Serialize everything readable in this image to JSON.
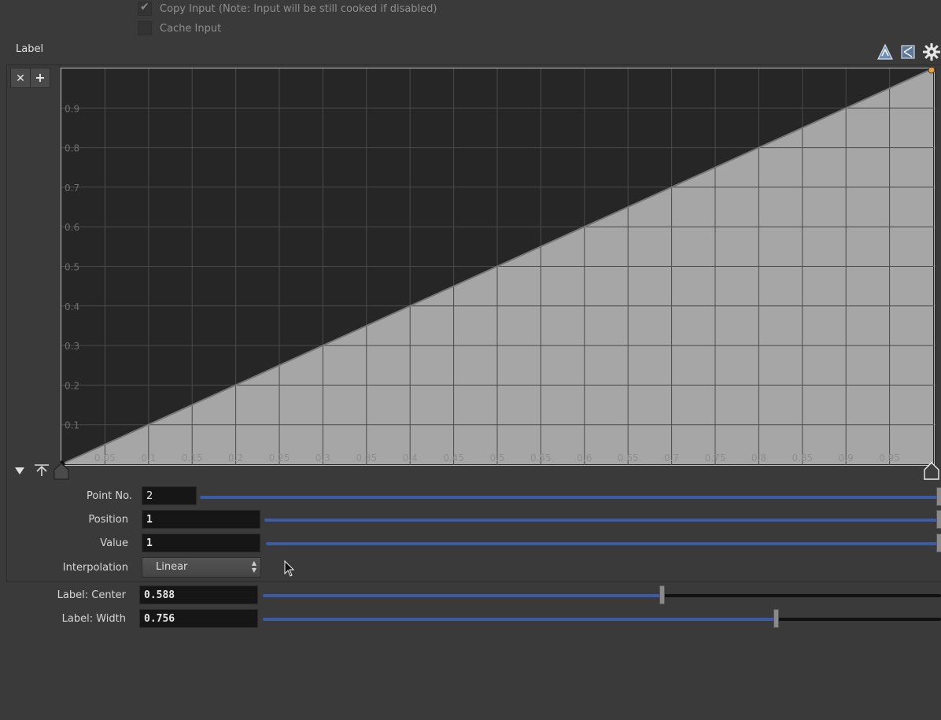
{
  "options": {
    "copy_input_label": "Copy Input (Note: Input will be still cooked if disabled)",
    "cache_input_label": "Cache Input"
  },
  "ramp": {
    "label": "Label",
    "remove_icon": "close-icon",
    "add_icon": "plus-icon",
    "toolbar_icons": [
      "zoom-fit-icon",
      "zoom-reset-icon",
      "gear-icon"
    ],
    "point_no_label": "Point No.",
    "point_no": "2",
    "point_no_fraction": 1.0,
    "position_label": "Position",
    "position": "1",
    "position_fraction": 1.0,
    "value_label": "Value",
    "value": "1",
    "value_fraction": 1.0,
    "interpolation_label": "Interpolation",
    "interpolation": "Linear"
  },
  "chart_data": {
    "type": "area",
    "x": [
      0,
      1
    ],
    "values": [
      0,
      1
    ],
    "xlim": [
      0,
      1
    ],
    "ylim": [
      0,
      1
    ],
    "x_ticks": [
      "0.05",
      "0.1",
      "0.15",
      "0.2",
      "0.25",
      "0.3",
      "0.35",
      "0.4",
      "0.45",
      "0.5",
      "0.55",
      "0.6",
      "0.65",
      "0.7",
      "0.75",
      "0.8",
      "0.85",
      "0.9",
      "0.95"
    ],
    "y_ticks": [
      "0.1",
      "0.2",
      "0.3",
      "0.4",
      "0.5",
      "0.6",
      "0.7",
      "0.8",
      "0.9"
    ],
    "grid": true,
    "colors": {
      "background": "#262626",
      "fill": "#a6a6a6",
      "grid": "#4a4a4a",
      "line": "#777777",
      "point": "#e8a23a"
    }
  },
  "label_params": {
    "center_label": "Label: Center",
    "center": "0.588",
    "center_fraction": 0.588,
    "width_label": "Label: Width",
    "width": "0.756",
    "width_fraction": 0.756
  }
}
